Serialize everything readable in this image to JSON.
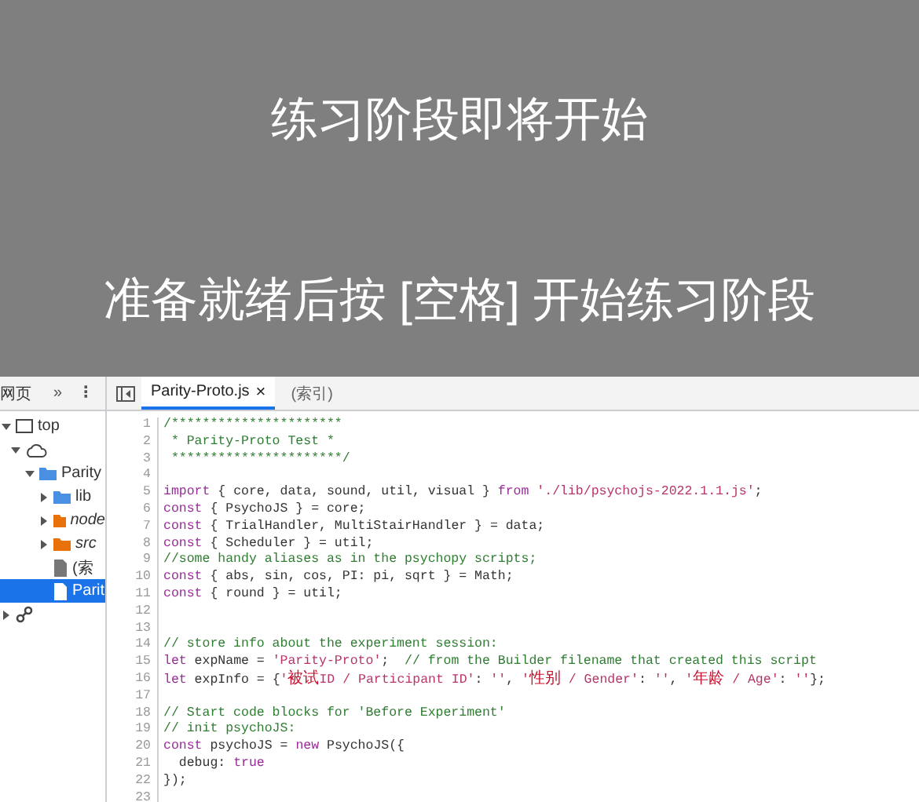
{
  "stage": {
    "title": "练习阶段即将开始",
    "instruction": "准备就绪后按 [空格] 开始练习阶段"
  },
  "navigator": {
    "tab": "网页",
    "more": "»",
    "menu": "⋮",
    "tree": [
      {
        "kind": "frame",
        "label": "top",
        "expanded": true,
        "selected": false,
        "children": [
          {
            "kind": "cloud",
            "expanded": true,
            "selected": false,
            "children": [
              {
                "kind": "folder",
                "label": "Parity",
                "color": "#4a90e2",
                "italic": false,
                "expanded": true,
                "selected": false,
                "children": [
                  {
                    "kind": "folder",
                    "label": "lib",
                    "color": "#4a90e2",
                    "italic": false,
                    "expanded": false,
                    "selected": false
                  },
                  {
                    "kind": "folder",
                    "label": "node",
                    "color": "#e8710a",
                    "italic": true,
                    "expanded": false,
                    "selected": false
                  },
                  {
                    "kind": "folder",
                    "label": "src",
                    "color": "#e8710a",
                    "italic": true,
                    "expanded": false,
                    "selected": false
                  },
                  {
                    "kind": "file",
                    "label": "(索",
                    "selected": false
                  },
                  {
                    "kind": "file",
                    "label": "Parit",
                    "selected": true
                  }
                ]
              }
            ]
          }
        ]
      },
      {
        "kind": "nodes",
        "expanded": false,
        "selected": false
      }
    ]
  },
  "editor_tabs": [
    {
      "label": "Parity-Proto.js",
      "close": "×",
      "selected": true
    },
    {
      "label": "(索引)",
      "selected": false
    }
  ],
  "code_lines": [
    {
      "number": "1",
      "segments": [
        {
          "kind": "comment",
          "text": "/**********************"
        }
      ]
    },
    {
      "number": "2",
      "segments": [
        {
          "kind": "comment",
          "text": " * Parity-Proto Test *"
        }
      ]
    },
    {
      "number": "3",
      "segments": [
        {
          "kind": "comment",
          "text": " **********************/"
        }
      ]
    },
    {
      "number": "4"
    },
    {
      "number": "5",
      "segments": [
        {
          "kind": "keyword",
          "text": "import"
        },
        {
          "kind": "plain",
          "text": " { core, data, sound, util, visual } "
        },
        {
          "kind": "keyword",
          "text": "from"
        },
        {
          "kind": "string",
          "text": " './lib/psychojs-2022.1.1.js'"
        },
        {
          "kind": "plain",
          "text": ";"
        }
      ]
    },
    {
      "number": "6",
      "segments": [
        {
          "kind": "keyword",
          "text": "const"
        },
        {
          "kind": "plain",
          "text": " { PsychoJS } = core;"
        }
      ]
    },
    {
      "number": "7",
      "segments": [
        {
          "kind": "keyword",
          "text": "const"
        },
        {
          "kind": "plain",
          "text": " { TrialHandler, MultiStairHandler } = data;"
        }
      ]
    },
    {
      "number": "8",
      "segments": [
        {
          "kind": "keyword",
          "text": "const"
        },
        {
          "kind": "plain",
          "text": " { Scheduler } = util;"
        }
      ]
    },
    {
      "number": "9",
      "segments": [
        {
          "kind": "comment",
          "text": "//some handy aliases as in the psychopy scripts;"
        }
      ]
    },
    {
      "number": "10",
      "segments": [
        {
          "kind": "keyword",
          "text": "const"
        },
        {
          "kind": "plain",
          "text": " { abs, sin, cos, PI: pi, sqrt } = Math;"
        }
      ]
    },
    {
      "number": "11",
      "segments": [
        {
          "kind": "keyword",
          "text": "const"
        },
        {
          "kind": "plain",
          "text": " { round } = util;"
        }
      ]
    },
    {
      "number": "12"
    },
    {
      "number": "13"
    },
    {
      "number": "14",
      "segments": [
        {
          "kind": "comment",
          "text": "// store info about the experiment session:"
        }
      ]
    },
    {
      "number": "15",
      "segments": [
        {
          "kind": "keyword",
          "text": "let"
        },
        {
          "kind": "plain",
          "text": " expName = "
        },
        {
          "kind": "string",
          "text": "'Parity-Proto'"
        },
        {
          "kind": "plain",
          "text": ";  "
        },
        {
          "kind": "comment",
          "text": "// from the Builder filename that created this script"
        }
      ]
    },
    {
      "number": "16",
      "segments": [
        {
          "kind": "keyword",
          "text": "let"
        },
        {
          "kind": "plain",
          "text": " expInfo = {"
        },
        {
          "kind": "string",
          "text": "'被试ID / Participant ID'"
        },
        {
          "kind": "plain",
          "text": ": "
        },
        {
          "kind": "string",
          "text": "''"
        },
        {
          "kind": "plain",
          "text": ", "
        },
        {
          "kind": "string",
          "text": "'性别 / Gender'"
        },
        {
          "kind": "plain",
          "text": ": "
        },
        {
          "kind": "string",
          "text": "''"
        },
        {
          "kind": "plain",
          "text": ", "
        },
        {
          "kind": "string",
          "text": "'年龄 / Age'"
        },
        {
          "kind": "plain",
          "text": ": "
        },
        {
          "kind": "string",
          "text": "''"
        },
        {
          "kind": "plain",
          "text": "};"
        }
      ]
    },
    {
      "number": "17"
    },
    {
      "number": "18",
      "segments": [
        {
          "kind": "comment",
          "text": "// Start code blocks for 'Before Experiment'"
        }
      ]
    },
    {
      "number": "19",
      "segments": [
        {
          "kind": "comment",
          "text": "// init psychoJS:"
        }
      ]
    },
    {
      "number": "20",
      "segments": [
        {
          "kind": "keyword",
          "text": "const"
        },
        {
          "kind": "plain",
          "text": " psychoJS = "
        },
        {
          "kind": "keyword",
          "text": "new"
        },
        {
          "kind": "plain",
          "text": " PsychoJS({"
        }
      ]
    },
    {
      "number": "21",
      "segments": [
        {
          "kind": "plain",
          "text": "  debug: "
        },
        {
          "kind": "keyword",
          "text": "true"
        }
      ]
    },
    {
      "number": "22",
      "segments": [
        {
          "kind": "plain",
          "text": "});"
        }
      ]
    },
    {
      "number": "23"
    }
  ]
}
